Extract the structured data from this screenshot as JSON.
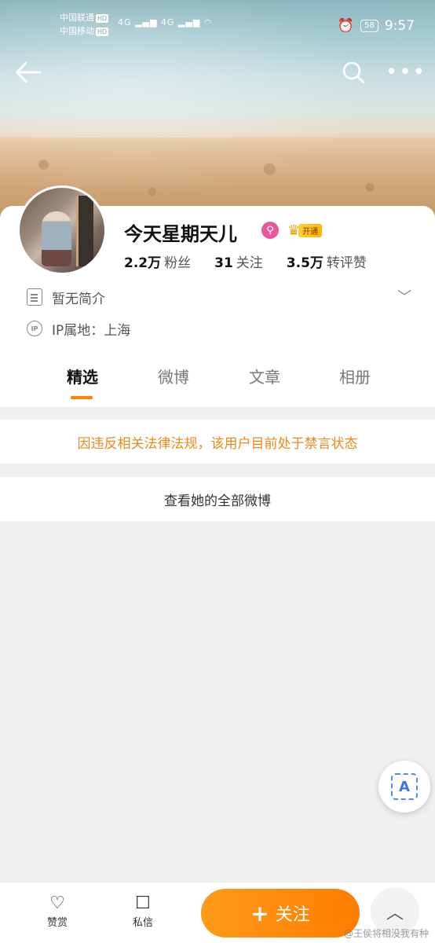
{
  "status_bar": {
    "carrier1": "中国联通",
    "carrier2": "中国移动",
    "hd": "HD",
    "signal": "4G",
    "battery": "58",
    "time": "9:57"
  },
  "profile": {
    "username": "今天星期天儿",
    "vip_open": "开通",
    "stats": [
      {
        "num": "2.2万",
        "label": "粉丝"
      },
      {
        "num": "31",
        "label": "关注"
      },
      {
        "num": "3.5万",
        "label": "转评赞"
      }
    ],
    "bio": "暂无简介",
    "ip_icon": "IP",
    "ip": "IP属地：上海"
  },
  "tabs": [
    "精选",
    "微博",
    "文章",
    "相册"
  ],
  "notice": "因违反相关法律法规，该用户目前处于禁言状态",
  "view_all": "查看她的全部微博",
  "float_icon": "A",
  "bottom": {
    "reward": "赞赏",
    "message": "私信",
    "follow": "关注",
    "plus": "+",
    "watermark": "@王侯将相没我有种"
  },
  "colors": {
    "accent": "#ff8200",
    "notice": "#e88a1a"
  }
}
